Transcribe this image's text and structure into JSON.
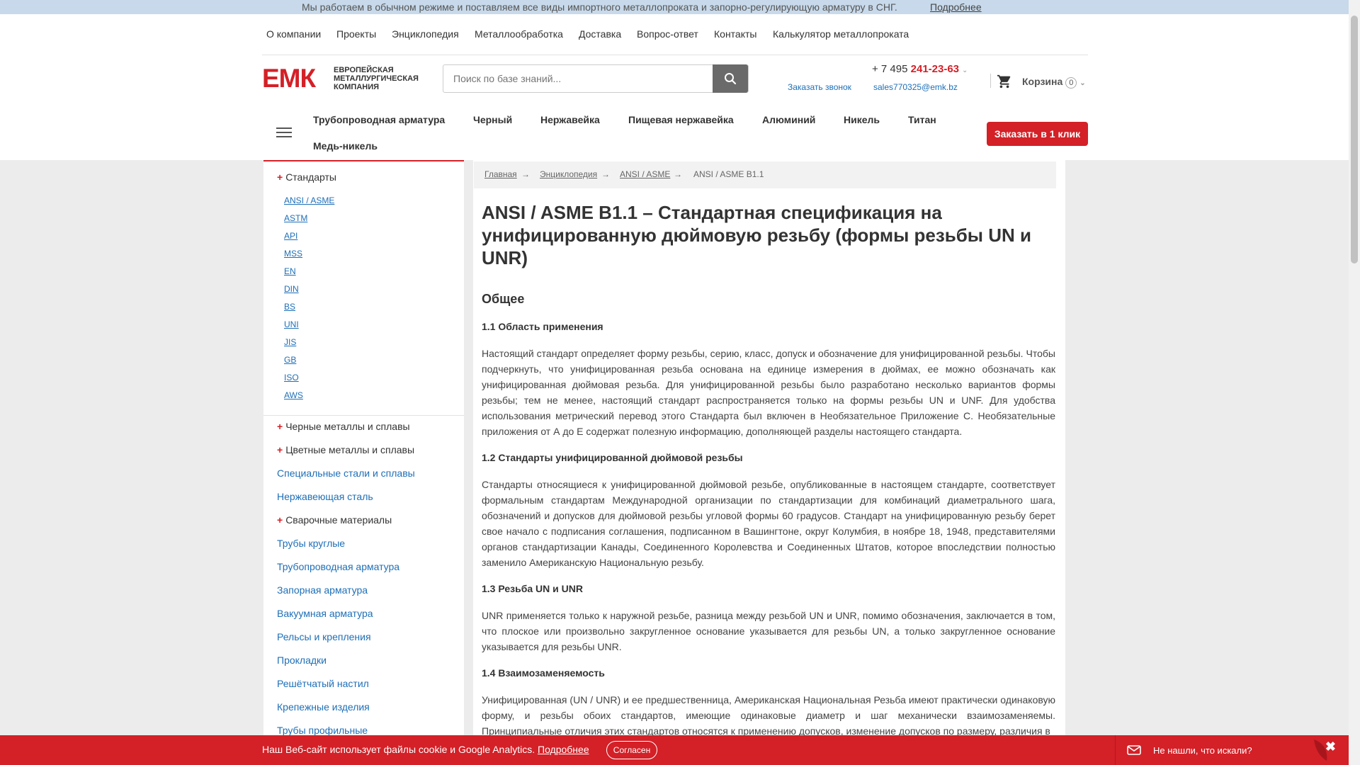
{
  "topbar": {
    "message": "Мы работаем в обычном режиме и поставляем все виды импортного металлопроката и запорно-регулирующую арматуру в СНГ.",
    "more_link": "Подробнее"
  },
  "topnav": [
    "О компании",
    "Проекты",
    "Энциклопедия",
    "Металлообработка",
    "Доставка",
    "Вопрос-ответ",
    "Контакты",
    "Калькулятор металлопроката"
  ],
  "logo": {
    "mark": "ЕМК",
    "line1": "ЕВРОПЕЙСКАЯ",
    "line2": "МЕТАЛЛУРГИЧЕСКАЯ",
    "line3": "КОМПАНИЯ"
  },
  "search": {
    "placeholder": "Поиск по базе знаний..."
  },
  "contacts": {
    "phone_prefix": "+ 7 495",
    "phone_main": "241-23-63",
    "callback": "Заказать звонок",
    "email": "sales770325@emk.bz"
  },
  "cart": {
    "label": "Корзина",
    "count": "0"
  },
  "catnav": [
    "Трубопроводная арматура",
    "Черный",
    "Нержавейка",
    "Пищевая нержавейка",
    "Алюминий",
    "Никель",
    "Титан",
    "Медь-никель"
  ],
  "order_button": "Заказать в 1 клик",
  "sidebar": {
    "standards_title": "Стандарты",
    "standards": [
      "ANSI / ASME",
      "ASTM",
      "API",
      "MSS",
      "EN",
      "DIN",
      "BS",
      "UNI",
      "JIS",
      "GB",
      "ISO",
      "AWS"
    ],
    "expandable": [
      "Черные металлы и сплавы",
      "Цветные металлы и сплавы"
    ],
    "links_a": [
      "Специальные стали и сплавы",
      "Нержавеющая сталь"
    ],
    "expandable_b": "Сварочные материалы",
    "links_b": [
      "Трубы круглые",
      "Трубопроводная арматура",
      "Запорная арматура",
      "Вакуумная арматура",
      "Рельсы и крепления",
      "Прокладки",
      "Решётчатый настил",
      "Крепежные изделия",
      "Трубы профильные"
    ]
  },
  "breadcrumbs": {
    "home": "Главная",
    "encyclopedia": "Энциклопедия",
    "section": "ANSI / ASME",
    "current": "ANSI / ASME B1.1",
    "arrow": "→"
  },
  "article": {
    "title": "ANSI / ASME B1.1 – Стандартная спецификация на унифицированную дюймовую резьбу (формы резьбы UN и UNR)",
    "section_general": "Общее",
    "s1_title": "1.1 Область применения",
    "s1_text": "Настоящий стандарт определяет форму резьбы, серию, класс, допуск и обозначение для унифицированной резьбы. Чтобы подчеркнуть, что унифицированная резьба основана на единице измерения в дюймах, ее можно обозначать как унифицированная дюймовая резьба. Для унифицированной резьбы было разработано несколько вариантов формы резьбы; тем не менее, настоящий стандарт распространяется только на формы резьбы UN и UNF. Для удобства использования метрический перевод этого Стандарта был включен в Необязательное Приложение С. Необязательные приложения от А до Е содержат полезную информацию, дополняющей разделы настоящего стандарта.",
    "s2_title": "1.2 Стандарты унифицированной дюймовой резьбы",
    "s2_text": "Стандарты относящиеся к унифицированной дюймовой резьбе, опубликованные в настоящем стандарте, соответствует формальным стандартам Международной организации по стандартизации для комбинаций диаметрального шага, обозначений и допусков для дюймовой резьбы угловой формы 60 градусов. Стандарт на унифицированную резьбу берет свое начало с подписания соглашения, подписанном в Вашингтоне, округ Колумбия, в ноябре 18, 1948, представителями органов стандартизации Канады, Соединенного Королевства и Соединенных Штатов, которое впоследствии полностью заменило Американскую Национальную резьбу.",
    "s3_title": "1.3 Резьба UN и UNR",
    "s3_text": "UNR применяется только к наружной резьбе, разница между резьбой UN и UNR, помимо обозначения, заключается в том, что плоское или произвольно закругленное основание указывается для резьбы UN, а только закругленное основание указывается для резьбы UNR.",
    "s4_title": "1.4 Взаимозаменяемость",
    "s4_text": "Унифицированная (UN / UNR) и ее предшественница, Американская Национальная Резьба имеют практически одинаковую форму, и резьбы обоих стандартов, имеющие одинаковые диаметр и шаг механически взаимозаменяемы. Принципиальные отличия этих стандартов относятся к применению допусков, изменение допусков по размеру, различия в"
  },
  "cookie": {
    "text": "Наш Веб-сайт использует файлы cookie и Google Analytics.",
    "link": "Подробнее",
    "agree": "Согласен"
  },
  "chat": {
    "text": "Не нашли, что искали?"
  },
  "colors": {
    "accent": "#d42027",
    "link": "#1e6fb7",
    "topbar": "#c7d9ea"
  }
}
